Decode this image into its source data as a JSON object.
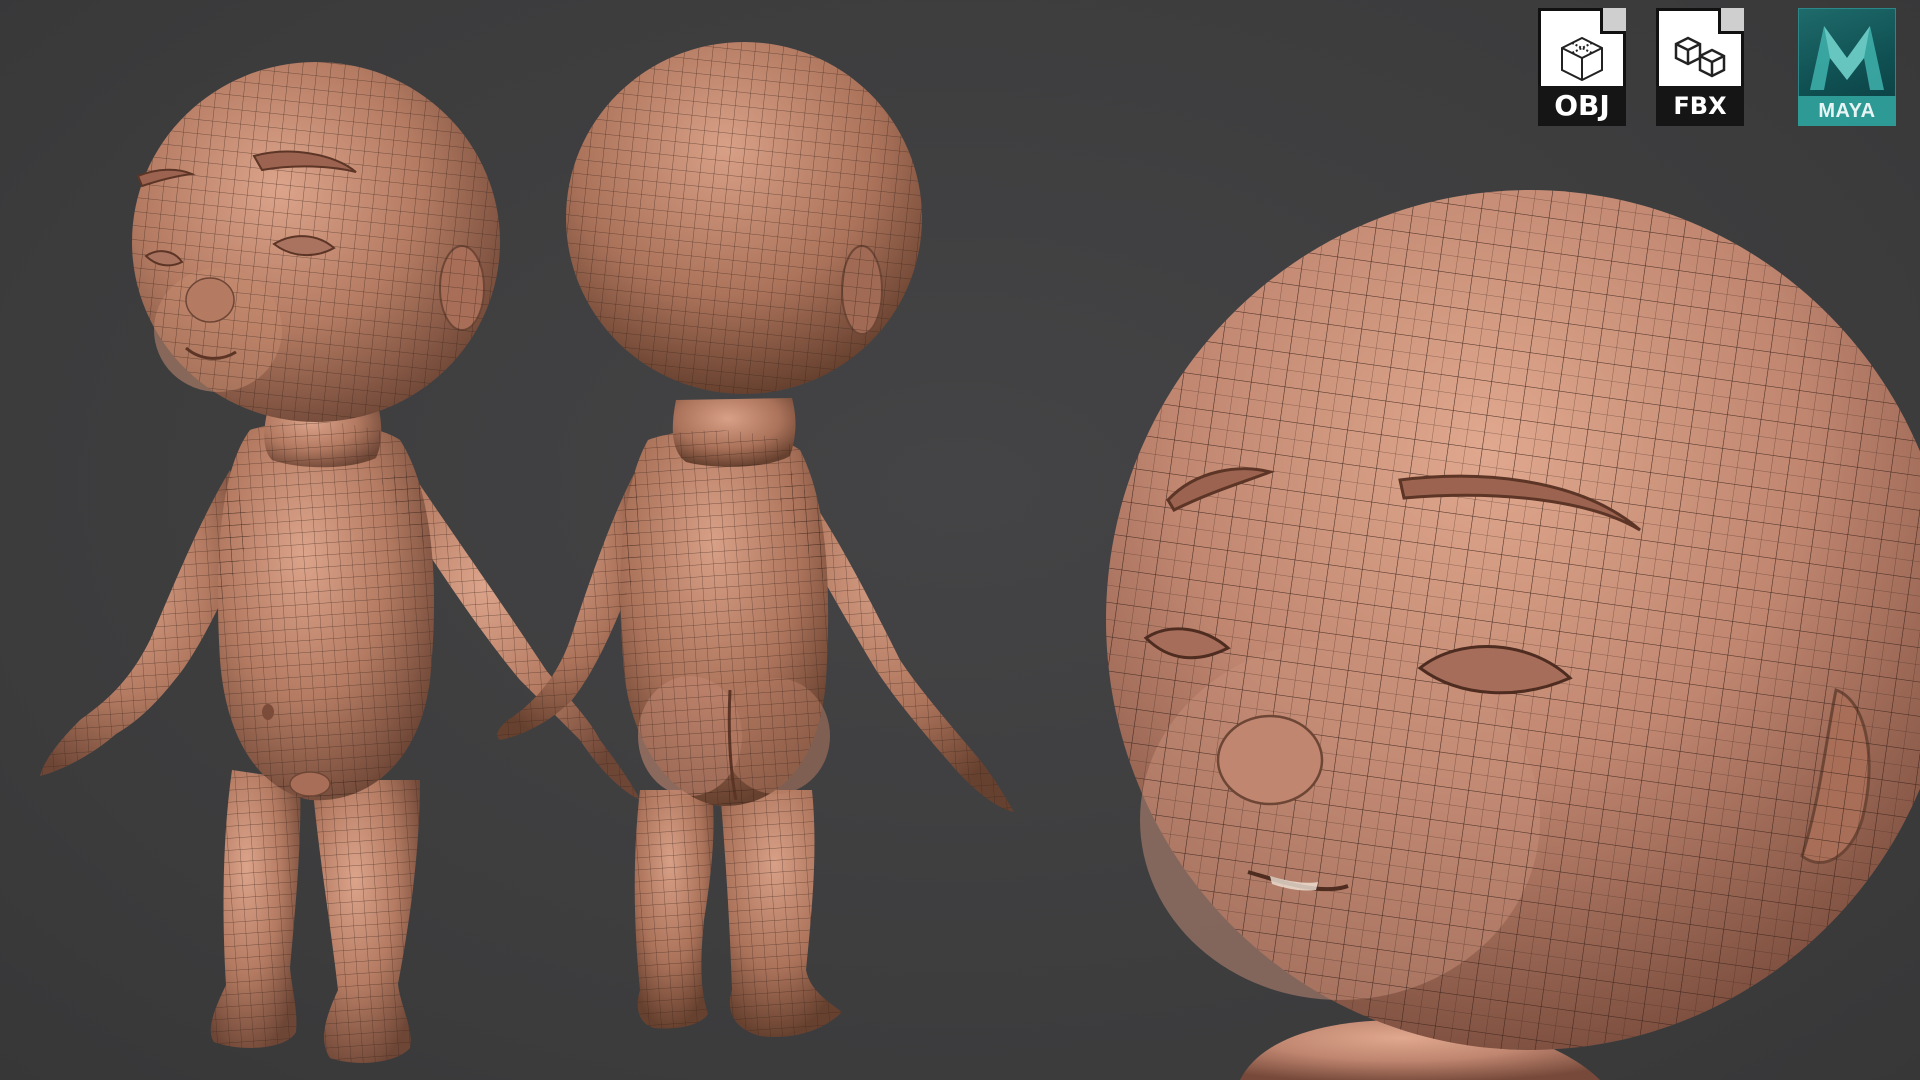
{
  "formats": {
    "obj": {
      "label": "OBJ",
      "icon": "wireframe-cube-icon"
    },
    "fbx": {
      "label": "FBX",
      "icon": "stacked-cubes-icon"
    },
    "maya": {
      "label": "MAYA",
      "icon": "maya-logo-icon"
    }
  },
  "views": [
    "front-three-quarter-view",
    "back-three-quarter-view",
    "head-close-up-view"
  ],
  "colors": {
    "background": "#3f3f40",
    "skin": "#b47b62",
    "skin_light": "#d49a80",
    "skin_shadow": "#6e4636",
    "wire": "#3a241c",
    "maya_teal": "#1f6b6b"
  }
}
